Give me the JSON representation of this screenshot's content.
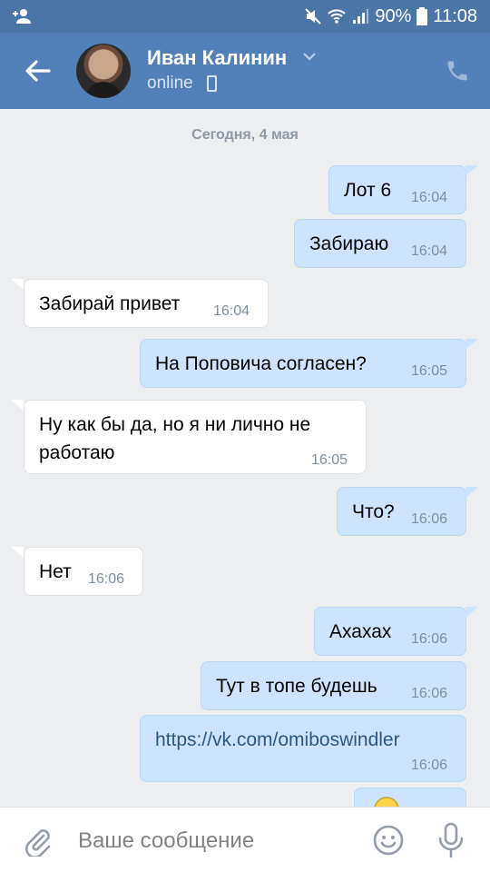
{
  "status_bar": {
    "battery": "90%",
    "time": "11:08"
  },
  "header": {
    "contact_name": "Иван Калинин",
    "presence": "online"
  },
  "chat": {
    "date_separator": "Сегодня, 4 мая",
    "messages": [
      {
        "dir": "out",
        "text": "Лот 6",
        "time": "16:04"
      },
      {
        "dir": "out",
        "text": "Забираю",
        "time": "16:04"
      },
      {
        "dir": "in",
        "text": "Забирай привет",
        "time": "16:04"
      },
      {
        "dir": "out",
        "text": "На Поповича согласен?",
        "time": "16:05"
      },
      {
        "dir": "in",
        "text_line1": "Ну как бы да, но я ни лично не",
        "text_line2": "работаю",
        "time": "16:05"
      },
      {
        "dir": "out",
        "text": "Что?",
        "time": "16:06"
      },
      {
        "dir": "in",
        "text": "Нет",
        "time": "16:06"
      },
      {
        "dir": "out",
        "text": "Ахахах",
        "time": "16:06"
      },
      {
        "dir": "out",
        "text": "Тут в топе будешь",
        "time": "16:06"
      },
      {
        "dir": "out",
        "text": "https://vk.com/omiboswindler",
        "time": "16:06"
      }
    ]
  },
  "composer": {
    "placeholder": "Ваше сообщение"
  },
  "colors": {
    "header": "#5181b8",
    "status": "#4a76a8",
    "outgoing": "#cce4ff",
    "incoming": "#ffffff",
    "background": "#edeef0",
    "link": "#2a5885"
  }
}
